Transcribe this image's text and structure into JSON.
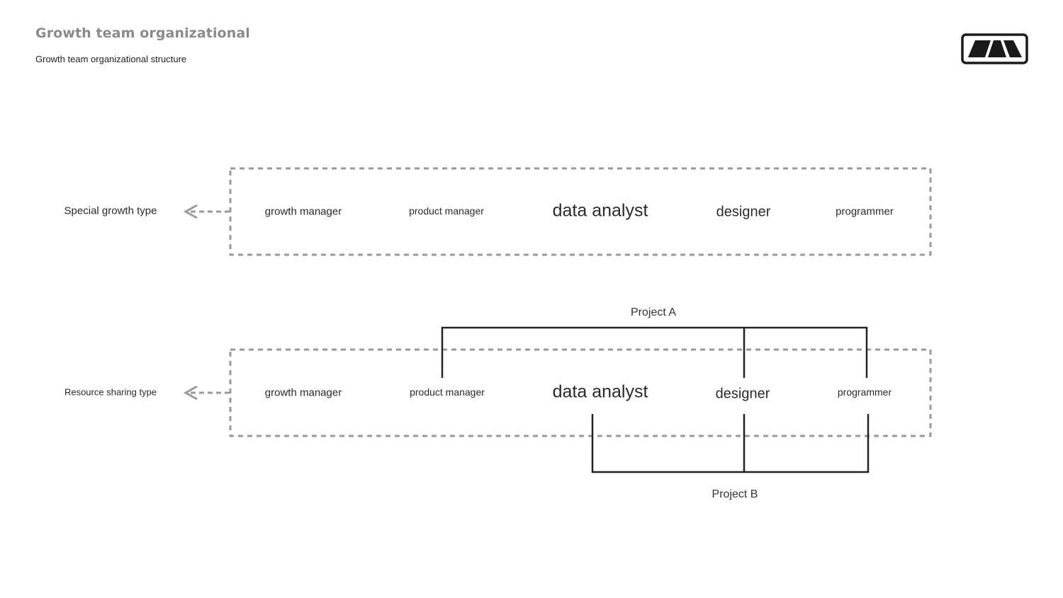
{
  "header": {
    "title": "Growth team organizational",
    "subtitle": "Growth team organizational structure",
    "logo_icon": "brand-logo-icon"
  },
  "colors": {
    "title": "#8a8a8a",
    "dashed_border": "#999999",
    "arrow": "#999999",
    "bracket": "#222222",
    "text": "#2a2a2a"
  },
  "rows": [
    {
      "type_label": "Special growth type",
      "roles": [
        "growth manager",
        "product manager",
        "data analyst",
        "designer",
        "programmer"
      ]
    },
    {
      "type_label": "Resource sharing type",
      "roles": [
        "growth manager",
        "product manager",
        "data analyst",
        "designer",
        "programmer"
      ]
    }
  ],
  "projects": [
    {
      "label": "Project A",
      "members": [
        "product manager",
        "designer",
        "programmer"
      ],
      "position": "above"
    },
    {
      "label": "Project B",
      "members": [
        "data analyst",
        "designer",
        "programmer"
      ],
      "position": "below"
    }
  ]
}
